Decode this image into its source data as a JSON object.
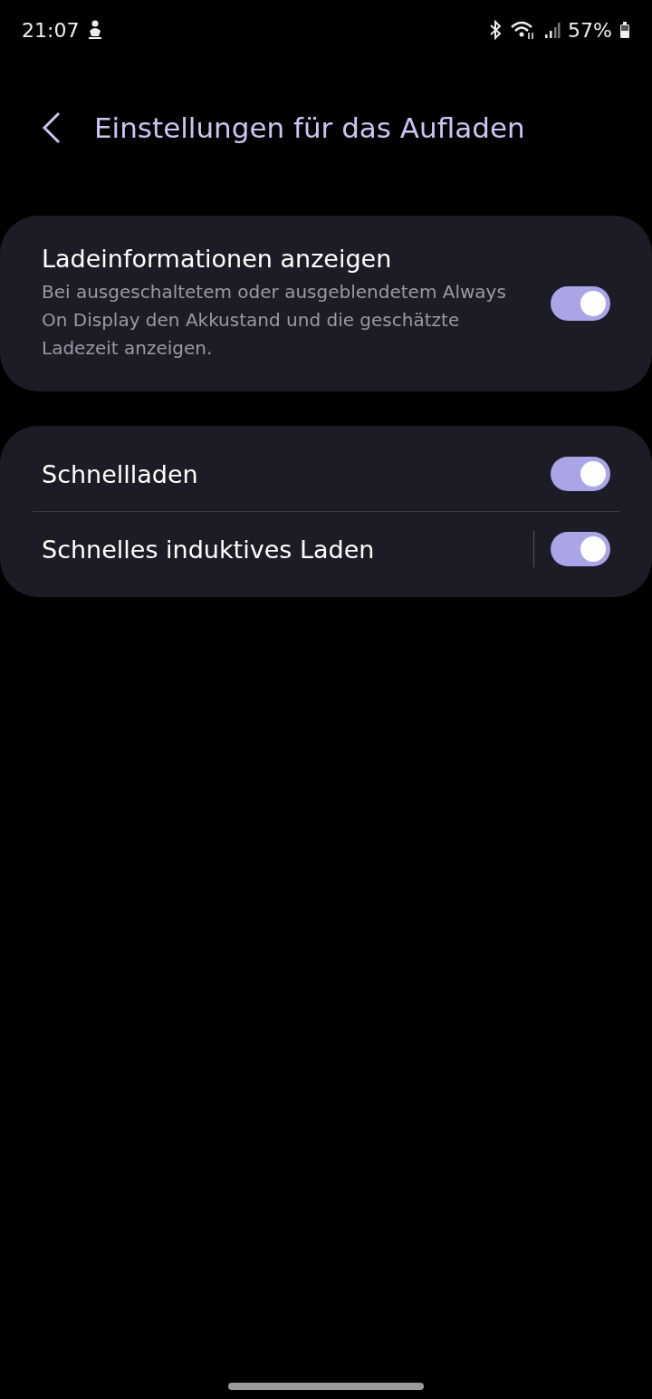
{
  "status_bar": {
    "time": "21:07",
    "battery": "57%"
  },
  "header": {
    "title": "Einstellungen für das Aufladen"
  },
  "groups": [
    {
      "items": [
        {
          "kind": "plain",
          "title": "Ladeinformationen anzeigen",
          "description": "Bei ausgeschaltetem oder ausgeblendetem Always On Display den Akkustand und die geschätzte Ladezeit anzeigen.",
          "on": true
        }
      ]
    },
    {
      "items": [
        {
          "kind": "plain",
          "title": "Schnellladen",
          "on": true
        },
        {
          "kind": "split",
          "title": "Schnelles induktives Laden",
          "on": true
        }
      ]
    }
  ]
}
